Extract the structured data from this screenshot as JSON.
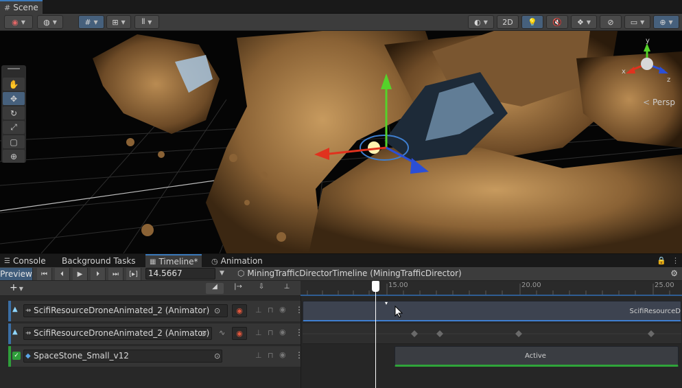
{
  "scene_tab": {
    "label": "Scene",
    "icon": "hash-icon"
  },
  "scene_toolbar": {
    "mode_2d": "2D",
    "view_label": "Persp"
  },
  "gizmo": {
    "x": "x",
    "y": "y",
    "z": "z"
  },
  "bottom_tabs": [
    {
      "label": "Console"
    },
    {
      "label": "Background Tasks"
    },
    {
      "label": "Timeline*"
    },
    {
      "label": "Animation"
    }
  ],
  "timeline": {
    "preview_label": "Preview",
    "current_time": "14.5667",
    "director_label": "MiningTrafficDirectorTimeline (MiningTrafficDirector)",
    "ruler": [
      "15.00",
      "20.00",
      "25.00"
    ],
    "tracks": [
      {
        "name": "ScifiResourceDroneAnimated_2 (Animator)"
      },
      {
        "name": "ScifiResourceDroneAnimated_2 (Animator)"
      },
      {
        "name": "SpaceStone_Small_v12"
      }
    ],
    "clip_label": "ScifiResourceD",
    "active_label": "Active"
  }
}
